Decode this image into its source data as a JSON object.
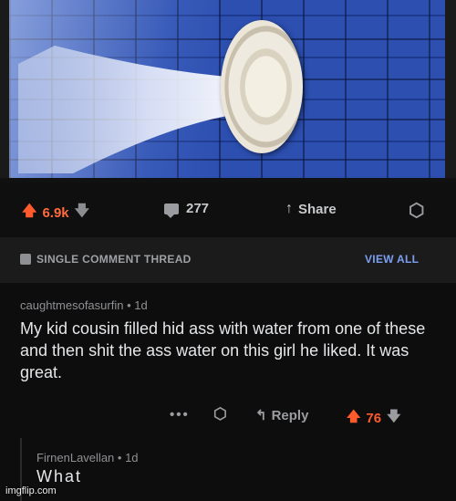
{
  "post": {
    "score": "6.9k",
    "comments_count": "277",
    "share_label": "Share"
  },
  "thread": {
    "title": "SINGLE COMMENT THREAD",
    "view_all": "VIEW ALL"
  },
  "comment": {
    "author": "caughtmesofasurfin",
    "age": "1d",
    "body": "My kid cousin filled hid ass with water from one of these and then shit the ass water on this girl he liked. It was great.",
    "reply_label": "Reply",
    "score": "76"
  },
  "reply": {
    "author": "FirnenLavellan",
    "age": "1d",
    "body": "What"
  },
  "watermark": "imgflip.com",
  "colors": {
    "upvote": "#ff5a2c",
    "link": "#7c9ff2",
    "background": "#0f0f10"
  },
  "icons": [
    "upvote-icon",
    "downvote-icon",
    "comment-icon",
    "share-icon",
    "award-icon",
    "more-icon",
    "reply-icon"
  ]
}
